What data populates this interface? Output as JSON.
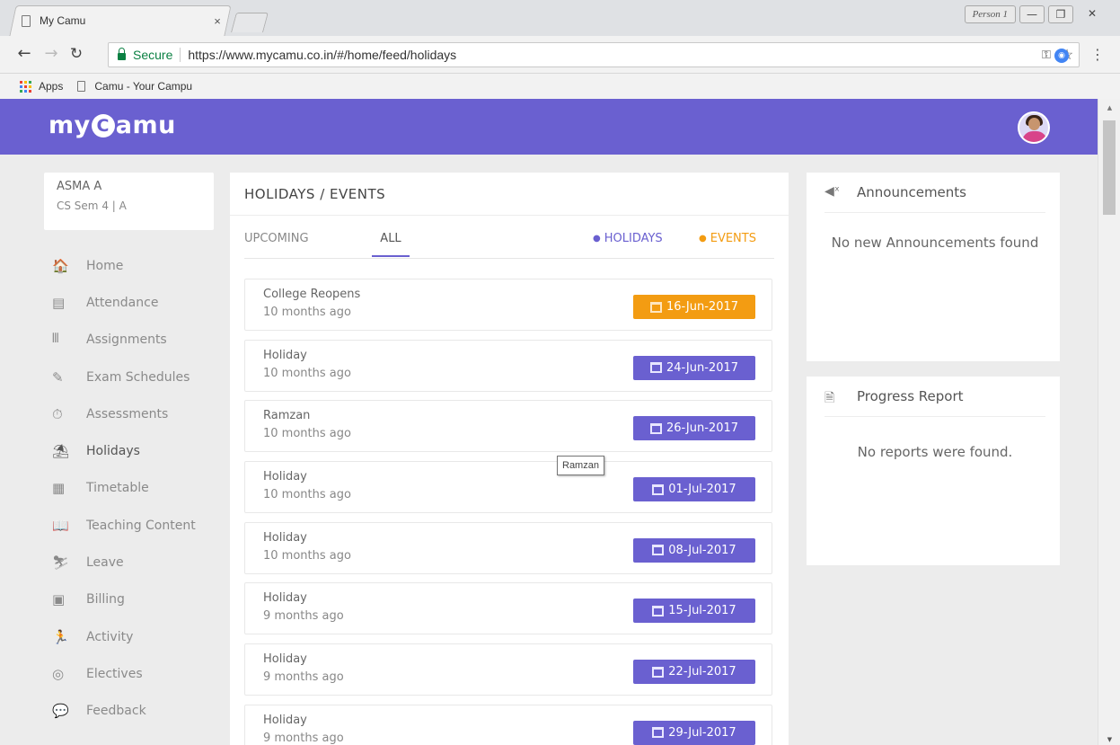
{
  "browser": {
    "tab_title": "My Camu",
    "tab_close": "×",
    "profile_label": "Person 1",
    "minimize": "—",
    "restore": "❐",
    "close": "✕",
    "secure_label": "Secure",
    "url": "https://www.mycamu.co.in/#/home/feed/holidays",
    "bookmarks": {
      "apps": "Apps",
      "camu": "Camu - Your Campu"
    },
    "colors": {
      "secure": "#0b8043"
    }
  },
  "app": {
    "logo": {
      "pre": "my",
      "mark": "C",
      "post": "amu"
    },
    "colors": {
      "primary": "#6a60d0",
      "event": "#f39c12"
    }
  },
  "user": {
    "name": "ASMA A",
    "sub": "CS Sem 4  | A"
  },
  "sidebar": {
    "items": [
      {
        "label": "Home",
        "icon": "home-icon",
        "glyph": "🏠"
      },
      {
        "label": "Attendance",
        "icon": "attendance-icon",
        "glyph": "▤"
      },
      {
        "label": "Assignments",
        "icon": "assignments-icon",
        "glyph": "𝍫"
      },
      {
        "label": "Exam Schedules",
        "icon": "exam-schedules-icon",
        "glyph": "✎"
      },
      {
        "label": "Assessments",
        "icon": "assessments-icon",
        "glyph": "⏱"
      },
      {
        "label": "Holidays",
        "icon": "holidays-icon",
        "glyph": "⛱"
      },
      {
        "label": "Timetable",
        "icon": "timetable-icon",
        "glyph": "▦"
      },
      {
        "label": "Teaching Content",
        "icon": "teaching-content-icon",
        "glyph": "📖"
      },
      {
        "label": "Leave",
        "icon": "leave-icon",
        "glyph": "⛷"
      },
      {
        "label": "Billing",
        "icon": "billing-icon",
        "glyph": "▣"
      },
      {
        "label": "Activity",
        "icon": "activity-icon",
        "glyph": "🏃"
      },
      {
        "label": "Electives",
        "icon": "electives-icon",
        "glyph": "◎"
      },
      {
        "label": "Feedback",
        "icon": "feedback-icon",
        "glyph": "💬"
      }
    ],
    "active": "Holidays"
  },
  "center": {
    "title": "HOLIDAYS / EVENTS",
    "tabs": {
      "upcoming": "UPCOMING",
      "all": "ALL",
      "active": "ALL"
    },
    "legend": {
      "holidays": "HOLIDAYS",
      "events": "EVENTS"
    },
    "events": [
      {
        "name": "College Reopens",
        "time": "10 months ago",
        "date": "16-Jun-2017",
        "kind": "event"
      },
      {
        "name": "Holiday",
        "time": "10 months ago",
        "date": "24-Jun-2017",
        "kind": "holiday"
      },
      {
        "name": "Ramzan",
        "time": "10 months ago",
        "date": "26-Jun-2017",
        "kind": "holiday"
      },
      {
        "name": "Holiday",
        "time": "10 months ago",
        "date": "01-Jul-2017",
        "kind": "holiday"
      },
      {
        "name": "Holiday",
        "time": "10 months ago",
        "date": "08-Jul-2017",
        "kind": "holiday"
      },
      {
        "name": "Holiday",
        "time": "9 months ago",
        "date": "15-Jul-2017",
        "kind": "holiday"
      },
      {
        "name": "Holiday",
        "time": "9 months ago",
        "date": "22-Jul-2017",
        "kind": "holiday"
      },
      {
        "name": "Holiday",
        "time": "9 months ago",
        "date": "29-Jul-2017",
        "kind": "holiday"
      }
    ],
    "tooltip": "Ramzan"
  },
  "announcements": {
    "title": "Announcements",
    "empty": "No new Announcements found"
  },
  "progress": {
    "title": "Progress Report",
    "empty": "No reports were found."
  }
}
